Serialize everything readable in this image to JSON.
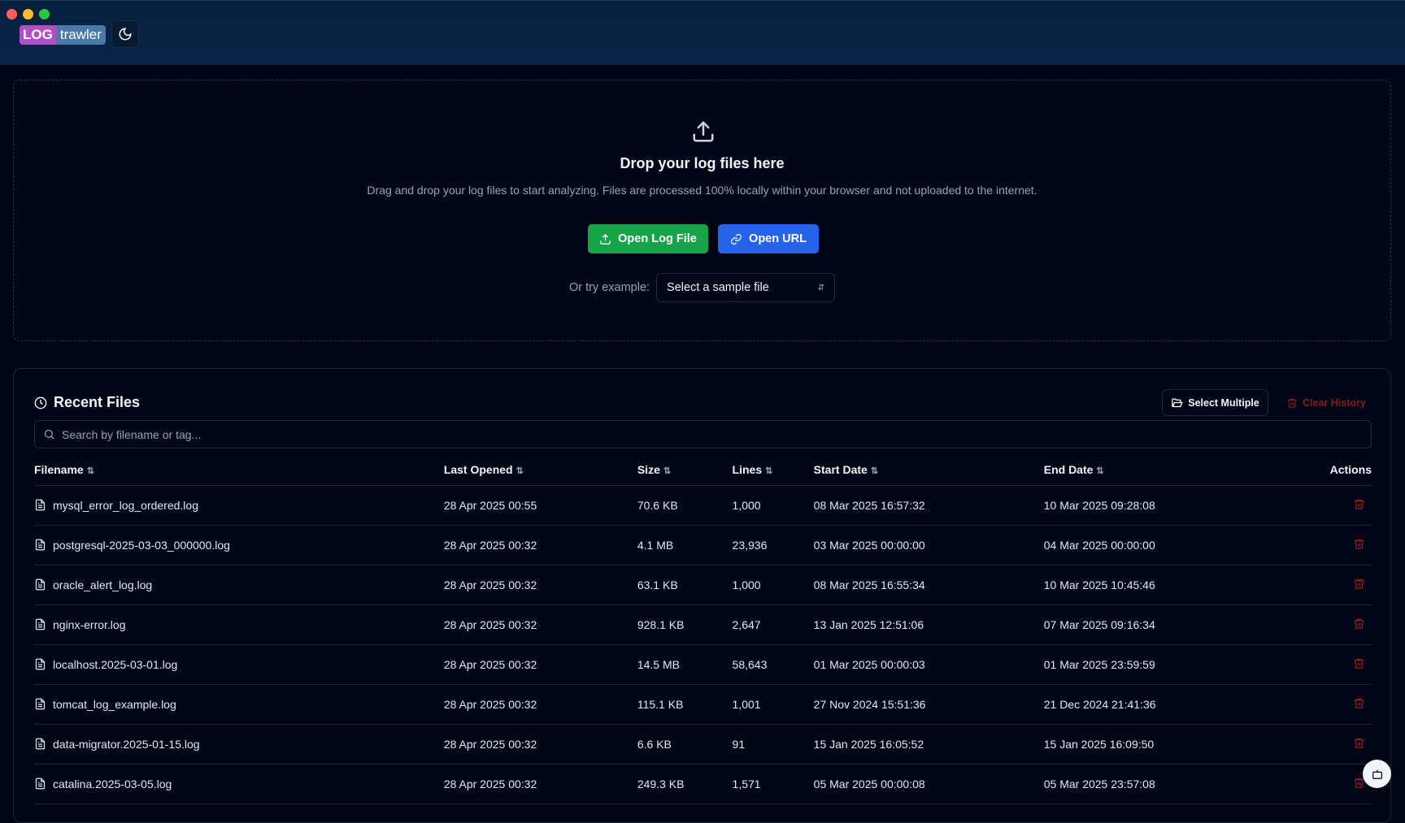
{
  "header": {
    "logo_a": "LOG",
    "logo_b": "trawler"
  },
  "drop": {
    "title": "Drop your log files here",
    "subtitle": "Drag and drop your log files to start analyzing. Files are processed 100% locally within your browser and not uploaded to the internet.",
    "open_file": "Open Log File",
    "open_url": "Open URL",
    "example_label": "Or try example:",
    "sample_select": "Select a sample file"
  },
  "recent": {
    "title": "Recent Files",
    "select_multiple": "Select Multiple",
    "clear_history": "Clear History",
    "search_placeholder": "Search by filename or tag...",
    "columns": [
      "Filename",
      "Last Opened",
      "Size",
      "Lines",
      "Start Date",
      "End Date",
      "Actions"
    ],
    "rows": [
      [
        "mysql_error_log_ordered.log",
        "28 Apr 2025 00:55",
        "70.6 KB",
        "1,000",
        "08 Mar 2025 16:57:32",
        "10 Mar 2025 09:28:08"
      ],
      [
        "postgresql-2025-03-03_000000.log",
        "28 Apr 2025 00:32",
        "4.1 MB",
        "23,936",
        "03 Mar 2025 00:00:00",
        "04 Mar 2025 00:00:00"
      ],
      [
        "oracle_alert_log.log",
        "28 Apr 2025 00:32",
        "63.1 KB",
        "1,000",
        "08 Mar 2025 16:55:34",
        "10 Mar 2025 10:45:46"
      ],
      [
        "nginx-error.log",
        "28 Apr 2025 00:32",
        "928.1 KB",
        "2,647",
        "13 Jan 2025 12:51:06",
        "07 Mar 2025 09:16:34"
      ],
      [
        "localhost.2025-03-01.log",
        "28 Apr 2025 00:32",
        "14.5 MB",
        "58,643",
        "01 Mar 2025 00:00:03",
        "01 Mar 2025 23:59:59"
      ],
      [
        "tomcat_log_example.log",
        "28 Apr 2025 00:32",
        "115.1 KB",
        "1,001",
        "27 Nov 2024 15:51:36",
        "21 Dec 2024 21:41:36"
      ],
      [
        "data-migrator.2025-01-15.log",
        "28 Apr 2025 00:32",
        "6.6 KB",
        "91",
        "15 Jan 2025 16:05:52",
        "15 Jan 2025 16:09:50"
      ],
      [
        "catalina.2025-03-05.log",
        "28 Apr 2025 00:32",
        "249.3 KB",
        "1,571",
        "05 Mar 2025 00:00:08",
        "05 Mar 2025 23:57:08"
      ]
    ]
  },
  "colors": {
    "green": "#16a34a",
    "blue": "#2563eb",
    "danger": "#991b1b"
  }
}
